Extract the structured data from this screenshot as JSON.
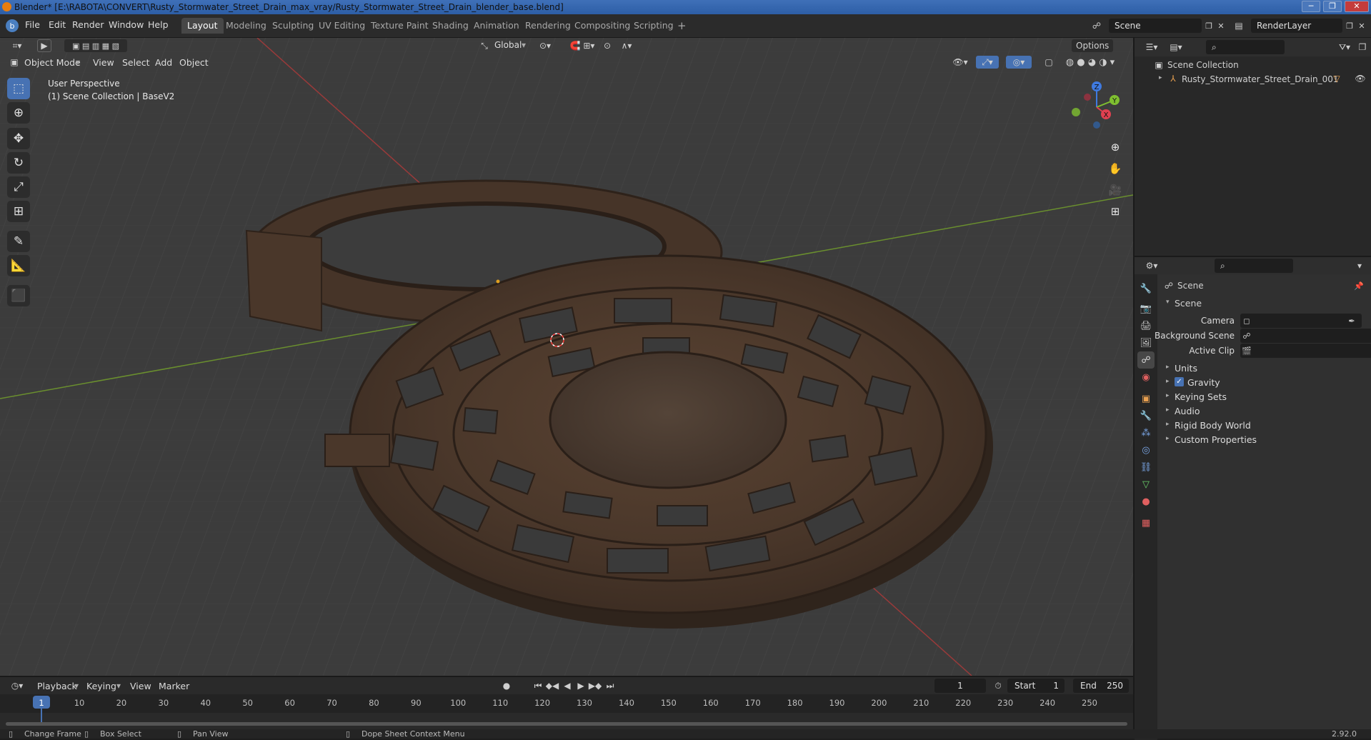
{
  "titlebar": {
    "title": "Blender* [E:\\RABOTA\\CONVERT\\Rusty_Stormwater_Street_Drain_max_vray/Rusty_Stormwater_Street_Drain_blender_base.blend]",
    "minimize": "─",
    "restore": "❐",
    "close": "✕"
  },
  "menubar": {
    "items": [
      "File",
      "Edit",
      "Render",
      "Window",
      "Help"
    ],
    "workspaces": [
      "Layout",
      "Modeling",
      "Sculpting",
      "UV Editing",
      "Texture Paint",
      "Shading",
      "Animation",
      "Rendering",
      "Compositing",
      "Scripting"
    ],
    "active_workspace": "Layout",
    "add_tab": "+",
    "scene_field": "Scene",
    "view_layer_field": "RenderLayer"
  },
  "viewport_header": {
    "mode": "Object Mode",
    "menus": [
      "View",
      "Select",
      "Add",
      "Object"
    ],
    "orientation": "Global",
    "options_label": "Options"
  },
  "viewport": {
    "perspective_label": "User Perspective",
    "collection_label": "(1) Scene Collection | BaseV2",
    "gizmo_labels": {
      "z": "Z",
      "y": "Y",
      "x": "X"
    }
  },
  "tools": [
    "select-box",
    "cursor",
    "move",
    "rotate",
    "scale",
    "transform",
    "annotate",
    "measure",
    "add-cube"
  ],
  "outliner": {
    "root": "Scene Collection",
    "items": [
      {
        "label": "Rusty_Stormwater_Street_Drain_001"
      }
    ]
  },
  "properties": {
    "header_title": "Scene",
    "panel_title": "Scene",
    "fields": [
      {
        "label": "Camera",
        "value": ""
      },
      {
        "label": "Background Scene",
        "value": ""
      },
      {
        "label": "Active Clip",
        "value": ""
      }
    ],
    "sections": [
      {
        "label": "Units",
        "checkbox": false
      },
      {
        "label": "Gravity",
        "checkbox": true
      },
      {
        "label": "Keying Sets",
        "checkbox": false
      },
      {
        "label": "Audio",
        "checkbox": false
      },
      {
        "label": "Rigid Body World",
        "checkbox": false
      },
      {
        "label": "Custom Properties",
        "checkbox": false
      }
    ]
  },
  "timeline": {
    "menus": [
      "Playback",
      "Keying",
      "View",
      "Marker"
    ],
    "current_frame": "1",
    "start_label": "Start",
    "start": "1",
    "end_label": "End",
    "end": "250",
    "ticks": [
      "1",
      "10",
      "20",
      "30",
      "40",
      "50",
      "60",
      "70",
      "80",
      "90",
      "100",
      "110",
      "120",
      "130",
      "140",
      "150",
      "160",
      "170",
      "180",
      "190",
      "200",
      "210",
      "220",
      "230",
      "240",
      "250"
    ]
  },
  "statusbar": {
    "items": [
      "Change Frame",
      "Box Select",
      "Pan View",
      "Dope Sheet Context Menu"
    ],
    "version": "2.92.0"
  },
  "colors": {
    "accent": "#4772b3",
    "titlebar": "#3f70b8",
    "panel": "#303030",
    "viewport_bg": "#3c3c3c"
  }
}
